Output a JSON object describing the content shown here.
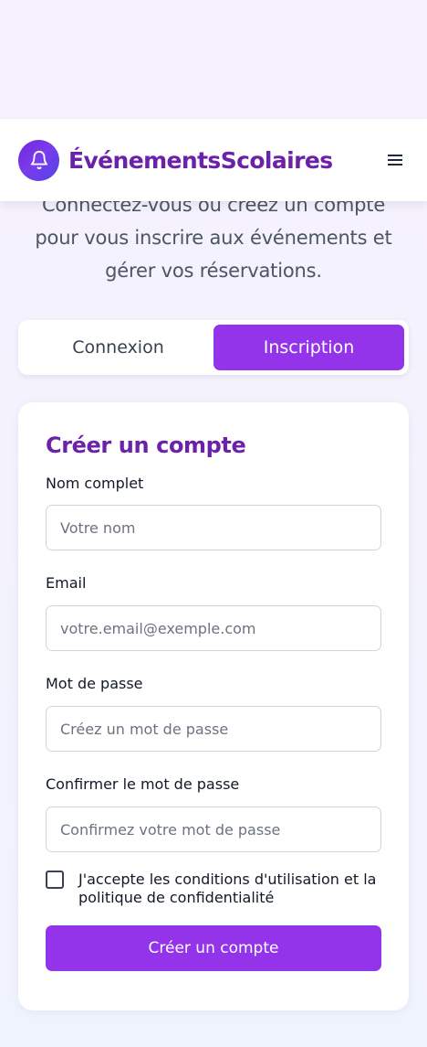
{
  "header": {
    "brand": "ÉvénementsScolaires",
    "logo_icon": "bell-icon",
    "menu_icon": "hamburger-menu-icon"
  },
  "intro": {
    "text": "Connectez-vous ou créez un compte pour vous inscrire aux événements et gérer vos réservations."
  },
  "tabs": [
    {
      "label": "Connexion",
      "active": false
    },
    {
      "label": "Inscription",
      "active": true
    }
  ],
  "form": {
    "title": "Créer un compte",
    "fields": {
      "name": {
        "label": "Nom complet",
        "placeholder": "Votre nom",
        "value": ""
      },
      "email": {
        "label": "Email",
        "placeholder": "votre.email@exemple.com",
        "value": ""
      },
      "password": {
        "label": "Mot de passe",
        "placeholder": "Créez un mot de passe",
        "value": ""
      },
      "confirm": {
        "label": "Confirmer le mot de passe",
        "placeholder": "Confirmez votre mot de passe",
        "value": ""
      }
    },
    "terms_label": "J'accepte les conditions d'utilisation et la politique de confidentialité",
    "terms_checked": false,
    "submit_label": "Créer un compte"
  },
  "colors": {
    "accent": "#9333ea",
    "brand_text": "#6b21a8"
  }
}
